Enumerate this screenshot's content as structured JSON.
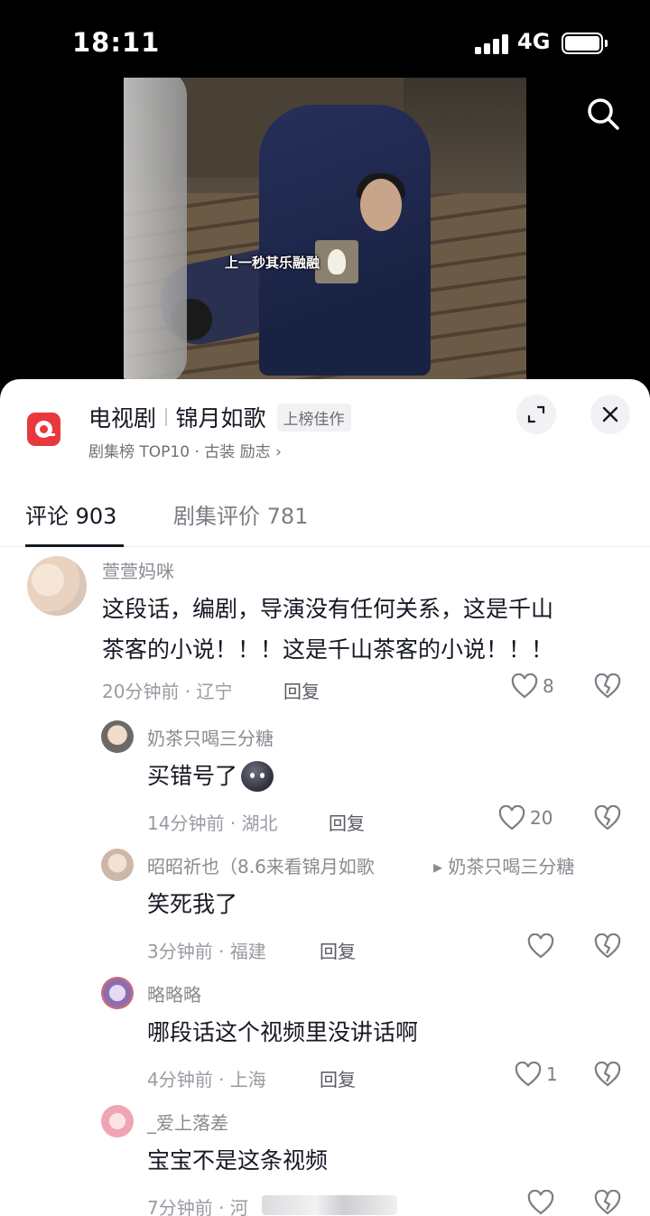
{
  "status_bar": {
    "time": "18:11",
    "network": "4G"
  },
  "video": {
    "caption": "上一秒其乐融融"
  },
  "panel": {
    "title": "电视剧",
    "drama_name": "锦月如歌",
    "badge": "上榜佳作",
    "subline": "剧集榜 TOP10 · 古装 励志 ›"
  },
  "tabs": [
    {
      "label": "评论 903",
      "active": true
    },
    {
      "label": "剧集评价 781",
      "active": false
    }
  ],
  "comments": [
    {
      "user": "萱萱妈咪",
      "text_line1": "这段话，编剧，导演没有任何关系，这是千山",
      "text_line2": "茶客的小说！！！这是千山茶客的小说！！！",
      "meta": "20分钟前 · 辽宁",
      "reply": "回复",
      "likes": "8"
    },
    {
      "user": "奶茶只喝三分糖",
      "text": "买错号了",
      "meta": "14分钟前 · 湖北",
      "reply": "回复",
      "likes": "20"
    },
    {
      "user": "昭昭祈也（8.6来看锦月如歌",
      "reply_to": "▸ 奶茶只喝三分糖",
      "text": "笑死我了",
      "meta": "3分钟前 · 福建",
      "reply": "回复",
      "likes": ""
    },
    {
      "user": "略略略",
      "text": "哪段话这个视频里没讲话啊",
      "meta": "4分钟前 · 上海",
      "reply": "回复",
      "likes": "1"
    },
    {
      "user": "_爱上落差",
      "text": "宝宝不是这条视频",
      "meta": "7分钟前 · 河",
      "reply": "",
      "likes": ""
    }
  ],
  "colors": {
    "accent_red": "#e8383d",
    "text_primary": "#161823",
    "text_secondary": "#8a8a92"
  }
}
